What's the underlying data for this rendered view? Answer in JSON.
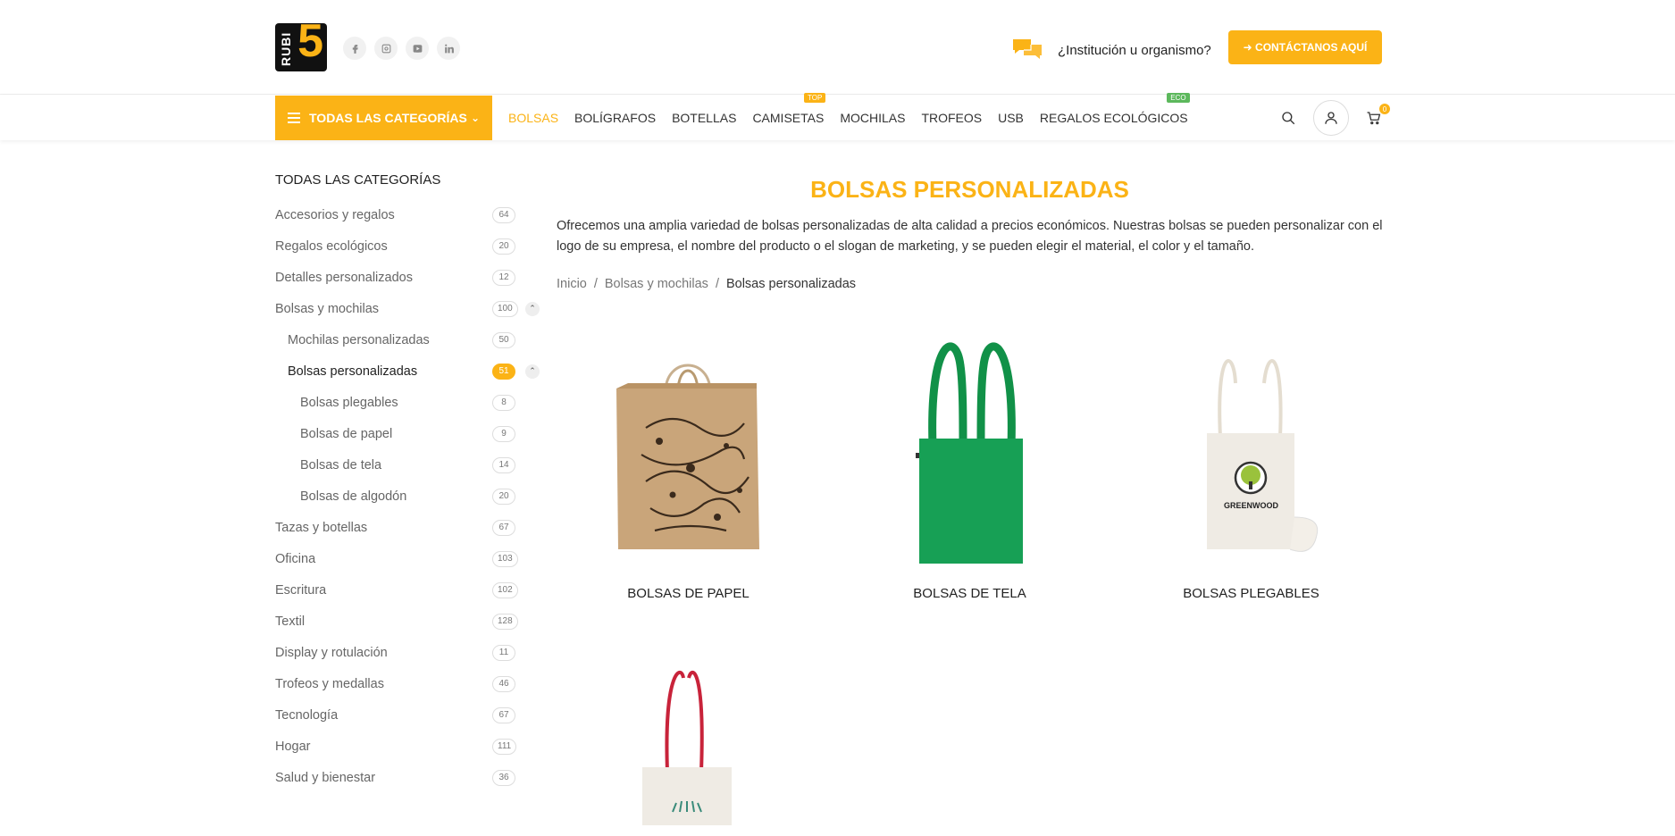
{
  "brand": {
    "logo_text_vertical": "RUBI",
    "logo_number": "5",
    "accent_color": "#fbb316"
  },
  "socials": [
    {
      "icon": "facebook-icon"
    },
    {
      "icon": "instagram-icon"
    },
    {
      "icon": "youtube-icon"
    },
    {
      "icon": "linkedin-icon"
    }
  ],
  "header": {
    "institution_text": "¿Institución u organismo?",
    "cta_label": "➜ CONTÁCTANOS AQUÍ"
  },
  "nav": {
    "all_categories_label": "TODAS LAS CATEGORÍAS",
    "links": [
      {
        "label": "BOLSAS",
        "active": true
      },
      {
        "label": "BOLÍGRAFOS"
      },
      {
        "label": "BOTELLAS"
      },
      {
        "label": "CAMISETAS",
        "badge": "TOP"
      },
      {
        "label": "MOCHILAS"
      },
      {
        "label": "TROFEOS"
      },
      {
        "label": "USB"
      },
      {
        "label": "REGALOS ECOLÓGICOS",
        "badge": "ECO"
      }
    ],
    "cart_count": "0"
  },
  "sidebar": {
    "title": "TODAS LAS CATEGORÍAS",
    "items": [
      {
        "label": "Accesorios y regalos",
        "count": "64",
        "level": 0
      },
      {
        "label": "Regalos ecológicos",
        "count": "20",
        "level": 0
      },
      {
        "label": "Detalles personalizados",
        "count": "12",
        "level": 0
      },
      {
        "label": "Bolsas y mochilas",
        "count": "100",
        "level": 0,
        "expanded": true
      },
      {
        "label": "Mochilas personalizadas",
        "count": "50",
        "level": 1
      },
      {
        "label": "Bolsas personalizadas",
        "count": "51",
        "level": 1,
        "current": true,
        "expanded": true
      },
      {
        "label": "Bolsas plegables",
        "count": "8",
        "level": 2
      },
      {
        "label": "Bolsas de papel",
        "count": "9",
        "level": 2
      },
      {
        "label": "Bolsas de tela",
        "count": "14",
        "level": 2
      },
      {
        "label": "Bolsas de algodón",
        "count": "20",
        "level": 2
      },
      {
        "label": "Tazas y botellas",
        "count": "67",
        "level": 0
      },
      {
        "label": "Oficina",
        "count": "103",
        "level": 0
      },
      {
        "label": "Escritura",
        "count": "102",
        "level": 0
      },
      {
        "label": "Textil",
        "count": "128",
        "level": 0
      },
      {
        "label": "Display y rotulación",
        "count": "11",
        "level": 0
      },
      {
        "label": "Trofeos y medallas",
        "count": "46",
        "level": 0
      },
      {
        "label": "Tecnología",
        "count": "67",
        "level": 0
      },
      {
        "label": "Hogar",
        "count": "111",
        "level": 0
      },
      {
        "label": "Salud y bienestar",
        "count": "36",
        "level": 0
      }
    ]
  },
  "main": {
    "title": "BOLSAS PERSONALIZADAS",
    "description": "Ofrecemos una amplia variedad de bolsas personalizadas de alta calidad a precios económicos. Nuestras bolsas se pueden personalizar con el logo de su empresa, el nombre del producto o el slogan de marketing, y se pueden elegir el material, el color y el tamaño.",
    "breadcrumb": [
      "Inicio",
      "Bolsas y mochilas",
      "Bolsas personalizadas"
    ],
    "products": [
      {
        "name": "BOLSAS DE PAPEL"
      },
      {
        "name": "BOLSAS DE TELA"
      },
      {
        "name": "BOLSAS PLEGABLES",
        "print_text": "GREENWOOD"
      },
      {
        "name": ""
      }
    ]
  }
}
